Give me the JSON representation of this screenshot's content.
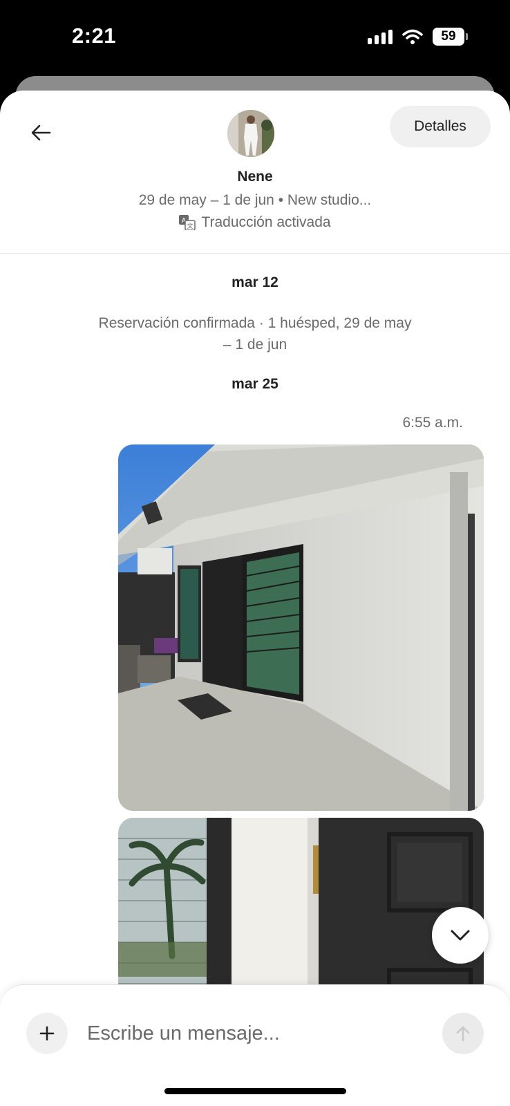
{
  "status_bar": {
    "time": "2:21",
    "battery": "59",
    "icons": [
      "cellular-signal-icon",
      "wifi-icon",
      "battery-icon"
    ]
  },
  "header": {
    "back_icon": "arrow-left-icon",
    "details_label": "Detalles",
    "host_name": "Nene",
    "trip_info": "29 de may – 1 de jun • New studio...",
    "translation_icon": "translate-icon",
    "translation_label": "Traducción activada"
  },
  "messages": {
    "date_1": "mar 12",
    "system_message": "Reservación confirmada · 1 huésped, 29 de may – 1 de jun",
    "date_2": "mar 25",
    "time": "6:55 a.m."
  },
  "composer": {
    "add_icon": "plus-icon",
    "placeholder": "Escribe un mensaje...",
    "send_icon": "arrow-up-icon"
  },
  "scroll_icon": "chevron-down-icon",
  "colors": {
    "background": "#ffffff",
    "primary_text": "#222222",
    "secondary_text": "#6a6a6a",
    "pill_background": "#f0f0f0"
  }
}
